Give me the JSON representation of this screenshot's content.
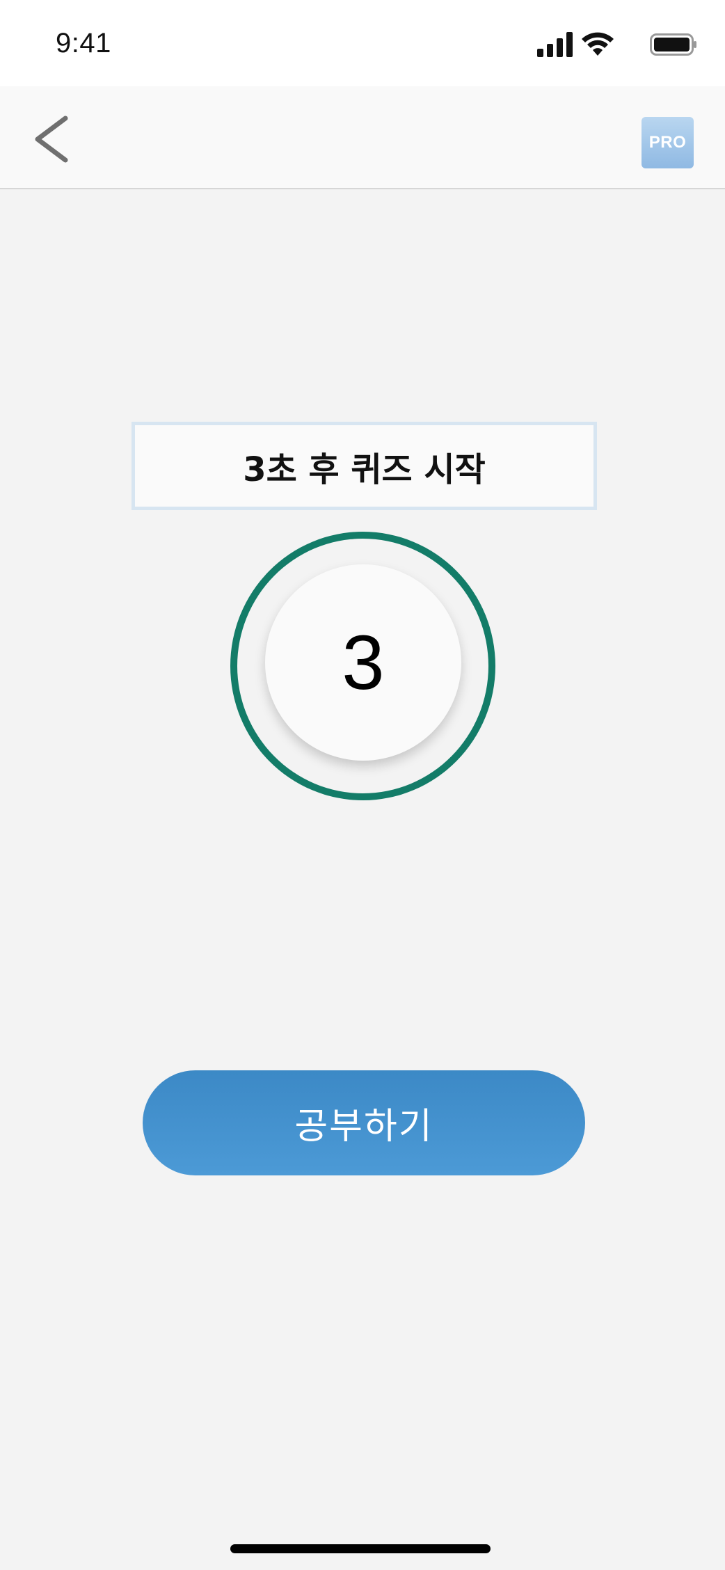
{
  "status_bar": {
    "time": "9:41",
    "icons": [
      "cellular-signal-icon",
      "wifi-icon",
      "battery-icon"
    ]
  },
  "nav_bar": {
    "back_icon": "chevron-left-icon",
    "pro_label": "PRO"
  },
  "quiz": {
    "banner_text": "3초 후 퀴즈 시작",
    "countdown_value": "3"
  },
  "actions": {
    "study_label": "공부하기"
  },
  "colors": {
    "background": "#f3f3f3",
    "ring": "#137c68",
    "button": "#3f8ecb",
    "pro_badge": "#9fc5ea"
  }
}
